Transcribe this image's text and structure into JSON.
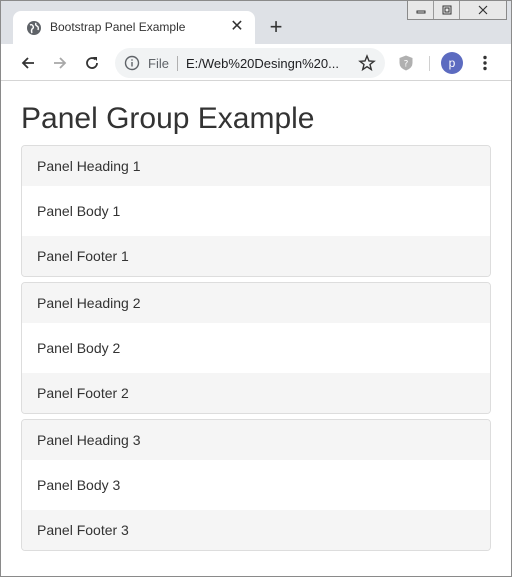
{
  "browser": {
    "tab_title": "Bootstrap Panel Example",
    "new_tab_symbol": "+",
    "close_symbol": "✕",
    "address": {
      "scheme": "File",
      "url": "E:/Web%20Desingn%20..."
    },
    "profile_initial": "p"
  },
  "page": {
    "title": "Panel Group Example",
    "panels": [
      {
        "heading": "Panel Heading 1",
        "body": "Panel Body 1",
        "footer": "Panel Footer 1"
      },
      {
        "heading": "Panel Heading 2",
        "body": "Panel Body 2",
        "footer": "Panel Footer 2"
      },
      {
        "heading": "Panel Heading 3",
        "body": "Panel Body 3",
        "footer": "Panel Footer 3"
      }
    ]
  },
  "colors": {
    "panel_bg": "#f5f5f5",
    "panel_border": "#dddddd",
    "text": "#333333",
    "avatar": "#5c6bc0"
  }
}
